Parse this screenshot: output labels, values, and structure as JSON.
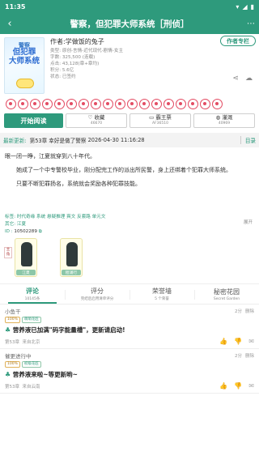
{
  "status": {
    "time": "11:35",
    "icons": [
      "wifi-icon",
      "signal-icon",
      "battery-icon"
    ]
  },
  "topbar": {
    "title": "警察，但犯罪大师系统［刑侦］"
  },
  "book": {
    "cover_lines": [
      "警察",
      "但犯罪",
      "大师系统"
    ],
    "author": "作者:学做饭的兔子",
    "type": "类型: 原创-言情-近代现代-剧情-女主",
    "chars": "字数: 325,500 (连载)",
    "clicks": "点击: 43,128(章+章均)",
    "score": "积分: 5.6亿",
    "status": "状态: 已签约",
    "author_column": "作者专栏"
  },
  "flowers": {
    "count": 18
  },
  "actions": {
    "start": "开始阅读",
    "collect": {
      "label": "收藏",
      "count": "46670"
    },
    "bawang": {
      "label": "霸王票",
      "count": "AF36510"
    },
    "nutrient": {
      "label": "灌溉",
      "count": "40969"
    }
  },
  "update": {
    "key": "最新更新:",
    "chapter": "第53章",
    "title": "幸好是做了警察",
    "time": "2026-04-30 11:16:28",
    "dir": "目录"
  },
  "intro": {
    "p1": "眼一闭一睁，江夏就穿到八十年代。",
    "p2": "她成了一个中专警校毕业，刚分配完工作的派出所民警，身上还绑着个犯罪大师系统。",
    "p3": "只要不断犯罪扬名，系统就会奖励各种犯罪技能。",
    "expand": "展开"
  },
  "tags": {
    "tag_key": "标签:",
    "tag_val": "时代奇缘 系统 悬疑推理 爽文 反套路 单元文",
    "other_key": "其它:",
    "other_val": "江夏",
    "id_key": "ID",
    "id_val": "10502289"
  },
  "characters": [
    {
      "name": "江夏",
      "tag": "主角"
    },
    {
      "name": "程涌行",
      "tag": ""
    }
  ],
  "tabs": [
    {
      "title": "评论",
      "sub": "10145条",
      "active": true
    },
    {
      "title": "评分",
      "sub": "完结后启用清单评分",
      "active": false
    },
    {
      "title": "荣誉墙",
      "sub": "5 个荣誉",
      "active": false
    },
    {
      "title": "秘密花园",
      "sub": "Secret Garden",
      "active": false
    }
  ],
  "comments": [
    {
      "user": "小鱼干",
      "time": "2分",
      "delete": "删除",
      "badges": [
        "100%",
        "萌萌花匠"
      ],
      "text_hl": "营养液已加满\"码字能量槽\"，更新请启动!",
      "chapter": "第53章",
      "location": "来自北京"
    },
    {
      "user": "催更进行中",
      "time": "2分",
      "delete": "删除",
      "badges": [
        "100%",
        "初级花匠"
      ],
      "text_hl": "营养液来啦~等更新哟~",
      "chapter": "第53章",
      "location": "来自云南"
    }
  ]
}
